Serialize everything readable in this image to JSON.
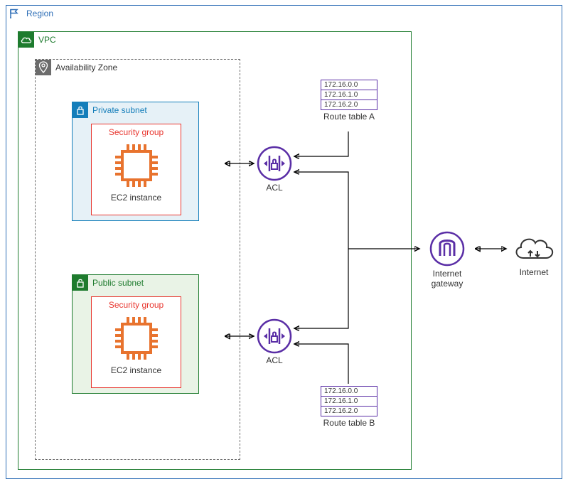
{
  "region": {
    "label": "Region"
  },
  "vpc": {
    "label": "VPC"
  },
  "az": {
    "label": "Availability Zone"
  },
  "private_subnet": {
    "label": "Private subnet",
    "security_group_label": "Security group",
    "instance_label": "EC2 instance"
  },
  "public_subnet": {
    "label": "Public subnet",
    "security_group_label": "Security group",
    "instance_label": "EC2 instance"
  },
  "route_table_a": {
    "rows": [
      "172.16.0.0",
      "172.16.1.0",
      "172.16.2.0"
    ],
    "label": "Route table A"
  },
  "route_table_b": {
    "rows": [
      "172.16.0.0",
      "172.16.1.0",
      "172.16.2.0"
    ],
    "label": "Route table B"
  },
  "acl_1": {
    "label": "ACL"
  },
  "acl_2": {
    "label": "ACL"
  },
  "internet_gateway": {
    "label": "Internet\ngateway"
  },
  "internet": {
    "label": "Internet"
  }
}
